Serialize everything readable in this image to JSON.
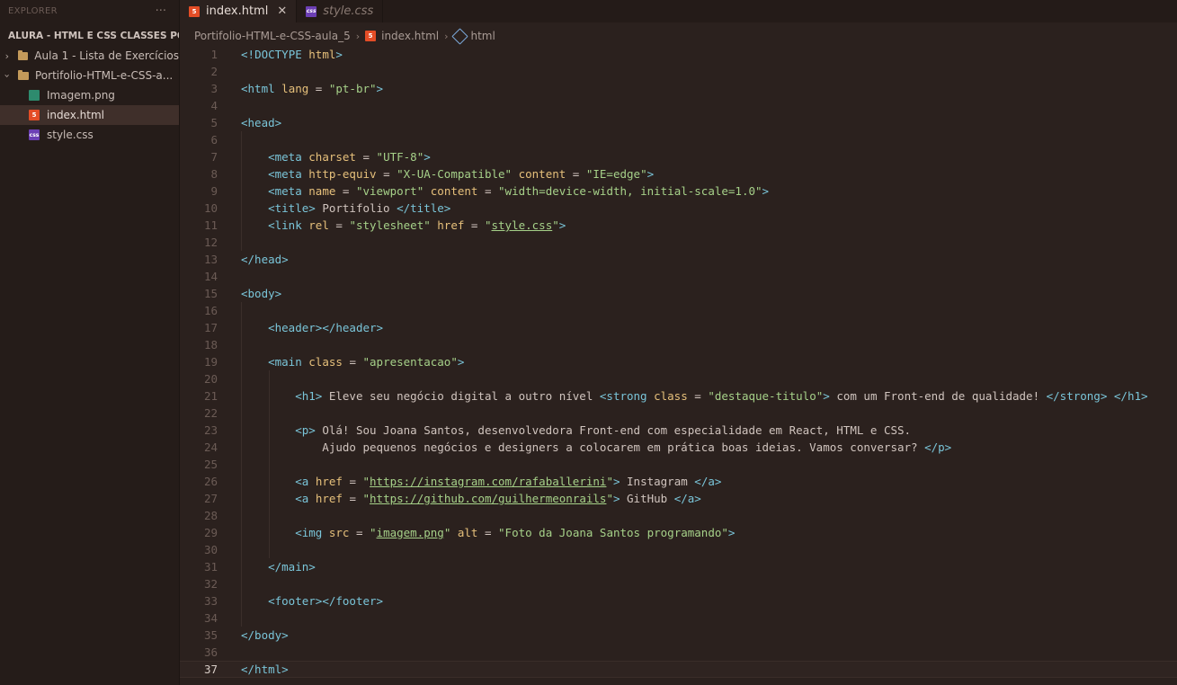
{
  "sidebar": {
    "title": "EXPLORER",
    "more_icon": "···",
    "root_label": "ALURA - HTML E CSS CLASSES PO...",
    "items": [
      {
        "label": "Aula 1 - Lista de Exercícios",
        "type": "folder",
        "expanded": false
      },
      {
        "label": "Portifolio-HTML-e-CSS-a...",
        "type": "folder",
        "expanded": true
      },
      {
        "label": "Imagem.png",
        "type": "image"
      },
      {
        "label": "index.html",
        "type": "html",
        "active": true
      },
      {
        "label": "style.css",
        "type": "css"
      }
    ]
  },
  "tabs": [
    {
      "label": "index.html",
      "active": true,
      "close_icon": "✕"
    },
    {
      "label": "style.css",
      "active": false
    }
  ],
  "breadcrumb": {
    "folder": "Portifolio-HTML-e-CSS-aula_5",
    "file": "index.html",
    "symbol": "html"
  },
  "editor": {
    "current_line": 37,
    "lines": [
      {
        "n": "1",
        "indent": 0,
        "parts": [
          [
            "t",
            "<!"
          ],
          [
            "t",
            "DOCTYPE"
          ],
          [
            "x",
            " "
          ],
          [
            "a",
            "html"
          ],
          [
            "t",
            ">"
          ]
        ]
      },
      {
        "n": "2",
        "indent": 0,
        "parts": []
      },
      {
        "n": "3",
        "indent": 0,
        "parts": [
          [
            "t",
            "<html"
          ],
          [
            "x",
            " "
          ],
          [
            "a",
            "lang"
          ],
          [
            "x",
            " = "
          ],
          [
            "s",
            "\"pt-br\""
          ],
          [
            "t",
            ">"
          ]
        ]
      },
      {
        "n": "4",
        "indent": 0,
        "parts": []
      },
      {
        "n": "5",
        "indent": 0,
        "parts": [
          [
            "t",
            "<head>"
          ]
        ]
      },
      {
        "n": "6",
        "indent": 1,
        "parts": []
      },
      {
        "n": "7",
        "indent": 1,
        "parts": [
          [
            "x",
            "    "
          ],
          [
            "t",
            "<meta"
          ],
          [
            "x",
            " "
          ],
          [
            "a",
            "charset"
          ],
          [
            "x",
            " = "
          ],
          [
            "s",
            "\"UTF-8\""
          ],
          [
            "t",
            ">"
          ]
        ]
      },
      {
        "n": "8",
        "indent": 1,
        "parts": [
          [
            "x",
            "    "
          ],
          [
            "t",
            "<meta"
          ],
          [
            "x",
            " "
          ],
          [
            "a",
            "http-equiv"
          ],
          [
            "x",
            " = "
          ],
          [
            "s",
            "\"X-UA-Compatible\""
          ],
          [
            "x",
            " "
          ],
          [
            "a",
            "content"
          ],
          [
            "x",
            " = "
          ],
          [
            "s",
            "\"IE=edge\""
          ],
          [
            "t",
            ">"
          ]
        ]
      },
      {
        "n": "9",
        "indent": 1,
        "parts": [
          [
            "x",
            "    "
          ],
          [
            "t",
            "<meta"
          ],
          [
            "x",
            " "
          ],
          [
            "a",
            "name"
          ],
          [
            "x",
            " = "
          ],
          [
            "s",
            "\"viewport\""
          ],
          [
            "x",
            " "
          ],
          [
            "a",
            "content"
          ],
          [
            "x",
            " = "
          ],
          [
            "s",
            "\"width=device-width, initial-scale=1.0\""
          ],
          [
            "t",
            ">"
          ]
        ]
      },
      {
        "n": "10",
        "indent": 1,
        "parts": [
          [
            "x",
            "    "
          ],
          [
            "t",
            "<title>"
          ],
          [
            "x",
            " Portifolio "
          ],
          [
            "t",
            "</title>"
          ]
        ]
      },
      {
        "n": "11",
        "indent": 1,
        "parts": [
          [
            "x",
            "    "
          ],
          [
            "t",
            "<link"
          ],
          [
            "x",
            " "
          ],
          [
            "a",
            "rel"
          ],
          [
            "x",
            " = "
          ],
          [
            "s",
            "\"stylesheet\""
          ],
          [
            "x",
            " "
          ],
          [
            "a",
            "href"
          ],
          [
            "x",
            " = "
          ],
          [
            "s",
            "\""
          ],
          [
            "u",
            "style.css"
          ],
          [
            "s",
            "\""
          ],
          [
            "t",
            ">"
          ]
        ]
      },
      {
        "n": "12",
        "indent": 1,
        "parts": []
      },
      {
        "n": "13",
        "indent": 0,
        "parts": [
          [
            "t",
            "</head>"
          ]
        ]
      },
      {
        "n": "14",
        "indent": 0,
        "parts": []
      },
      {
        "n": "15",
        "indent": 0,
        "parts": [
          [
            "t",
            "<body>"
          ]
        ]
      },
      {
        "n": "16",
        "indent": 1,
        "parts": []
      },
      {
        "n": "17",
        "indent": 1,
        "parts": [
          [
            "x",
            "    "
          ],
          [
            "t",
            "<header></header>"
          ]
        ]
      },
      {
        "n": "18",
        "indent": 1,
        "parts": []
      },
      {
        "n": "19",
        "indent": 1,
        "parts": [
          [
            "x",
            "    "
          ],
          [
            "t",
            "<main"
          ],
          [
            "x",
            " "
          ],
          [
            "a",
            "class"
          ],
          [
            "x",
            " = "
          ],
          [
            "s",
            "\"apresentacao\""
          ],
          [
            "t",
            ">"
          ]
        ]
      },
      {
        "n": "20",
        "indent": 2,
        "parts": []
      },
      {
        "n": "21",
        "indent": 2,
        "parts": [
          [
            "x",
            "        "
          ],
          [
            "t",
            "<h1>"
          ],
          [
            "x",
            " Eleve seu negócio digital a outro nível "
          ],
          [
            "t",
            "<strong"
          ],
          [
            "x",
            " "
          ],
          [
            "a",
            "class"
          ],
          [
            "x",
            " = "
          ],
          [
            "s",
            "\"destaque-titulo\""
          ],
          [
            "t",
            ">"
          ],
          [
            "x",
            " com um Front-end de qualidade! "
          ],
          [
            "t",
            "</strong>"
          ],
          [
            "x",
            " "
          ],
          [
            "t",
            "</h1>"
          ]
        ]
      },
      {
        "n": "22",
        "indent": 2,
        "parts": []
      },
      {
        "n": "23",
        "indent": 2,
        "parts": [
          [
            "x",
            "        "
          ],
          [
            "t",
            "<p>"
          ],
          [
            "x",
            " Olá! Sou Joana Santos, desenvolvedora Front-end com especialidade em React, HTML e CSS."
          ]
        ]
      },
      {
        "n": "24",
        "indent": 2,
        "parts": [
          [
            "x",
            "            Ajudo pequenos negócios e designers a colocarem em prática boas ideias. Vamos conversar? "
          ],
          [
            "t",
            "</p>"
          ]
        ]
      },
      {
        "n": "25",
        "indent": 2,
        "parts": []
      },
      {
        "n": "26",
        "indent": 2,
        "parts": [
          [
            "x",
            "        "
          ],
          [
            "t",
            "<a"
          ],
          [
            "x",
            " "
          ],
          [
            "a",
            "href"
          ],
          [
            "x",
            " = "
          ],
          [
            "s",
            "\""
          ],
          [
            "u",
            "https://instagram.com/rafaballerini"
          ],
          [
            "s",
            "\""
          ],
          [
            "t",
            ">"
          ],
          [
            "x",
            " Instagram "
          ],
          [
            "t",
            "</a>"
          ]
        ]
      },
      {
        "n": "27",
        "indent": 2,
        "parts": [
          [
            "x",
            "        "
          ],
          [
            "t",
            "<a"
          ],
          [
            "x",
            " "
          ],
          [
            "a",
            "href"
          ],
          [
            "x",
            " = "
          ],
          [
            "s",
            "\""
          ],
          [
            "u",
            "https://github.com/guilhermeonrails"
          ],
          [
            "s",
            "\""
          ],
          [
            "t",
            ">"
          ],
          [
            "x",
            " GitHub "
          ],
          [
            "t",
            "</a>"
          ]
        ]
      },
      {
        "n": "28",
        "indent": 2,
        "parts": []
      },
      {
        "n": "29",
        "indent": 2,
        "parts": [
          [
            "x",
            "        "
          ],
          [
            "t",
            "<img"
          ],
          [
            "x",
            " "
          ],
          [
            "a",
            "src"
          ],
          [
            "x",
            " = "
          ],
          [
            "s",
            "\""
          ],
          [
            "u",
            "imagem.png"
          ],
          [
            "s",
            "\""
          ],
          [
            "x",
            " "
          ],
          [
            "a",
            "alt"
          ],
          [
            "x",
            " = "
          ],
          [
            "s",
            "\"Foto da Joana Santos programando\""
          ],
          [
            "t",
            ">"
          ]
        ]
      },
      {
        "n": "30",
        "indent": 2,
        "parts": []
      },
      {
        "n": "31",
        "indent": 1,
        "parts": [
          [
            "x",
            "    "
          ],
          [
            "t",
            "</main>"
          ]
        ]
      },
      {
        "n": "32",
        "indent": 1,
        "parts": []
      },
      {
        "n": "33",
        "indent": 1,
        "parts": [
          [
            "x",
            "    "
          ],
          [
            "t",
            "<footer></footer>"
          ]
        ]
      },
      {
        "n": "34",
        "indent": 1,
        "parts": []
      },
      {
        "n": "35",
        "indent": 0,
        "parts": [
          [
            "t",
            "</body>"
          ]
        ]
      },
      {
        "n": "36",
        "indent": 0,
        "parts": []
      },
      {
        "n": "37",
        "indent": 0,
        "parts": [
          [
            "t",
            "</html>"
          ]
        ]
      }
    ]
  },
  "colors": {
    "tag": "#7ac5d9",
    "attr": "#e6c07b",
    "string": "#a6d189",
    "text": "#d0c4be",
    "background": "#2b211e",
    "sidebar": "#251c19",
    "active_item": "#3f2f2a"
  },
  "icons": {
    "folder": "folder-icon",
    "image": "image-file-icon",
    "html": "html5-file-icon",
    "css": "css-file-icon",
    "symbol": "cube-symbol-icon"
  }
}
